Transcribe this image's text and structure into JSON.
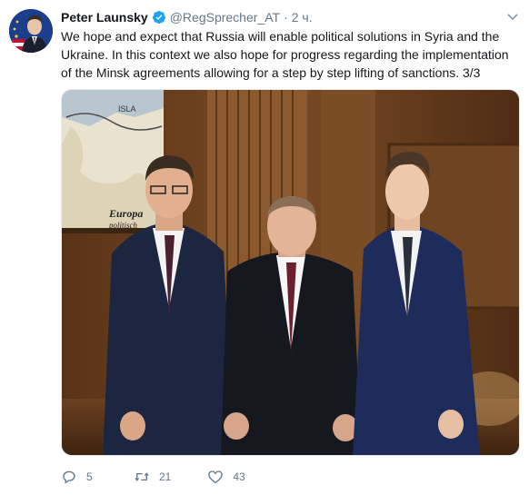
{
  "tweet": {
    "author_name": "Peter Launsky",
    "handle": "@RegSprecher_AT",
    "separator": "·",
    "time": "2 ч.",
    "text": "We hope and expect that Russia will enable political solutions in Syria and the Ukraine. In this context we also hope for progress regarding the implementation of the Minsk agreements allowing for a step by step lifting of sanctions. 3/3",
    "photo": {
      "map_text_europa": "Europa",
      "map_text_politisch": "politisch",
      "map_text_isla": "ISLA"
    }
  },
  "actions": {
    "reply_count": "5",
    "retweet_count": "21",
    "like_count": "43"
  },
  "colors": {
    "verified": "#1da1f2",
    "text_primary": "#14171a",
    "text_secondary": "#657786"
  },
  "icons": [
    "verified-badge-icon",
    "caret-down-icon",
    "reply-icon",
    "retweet-icon",
    "like-icon"
  ]
}
